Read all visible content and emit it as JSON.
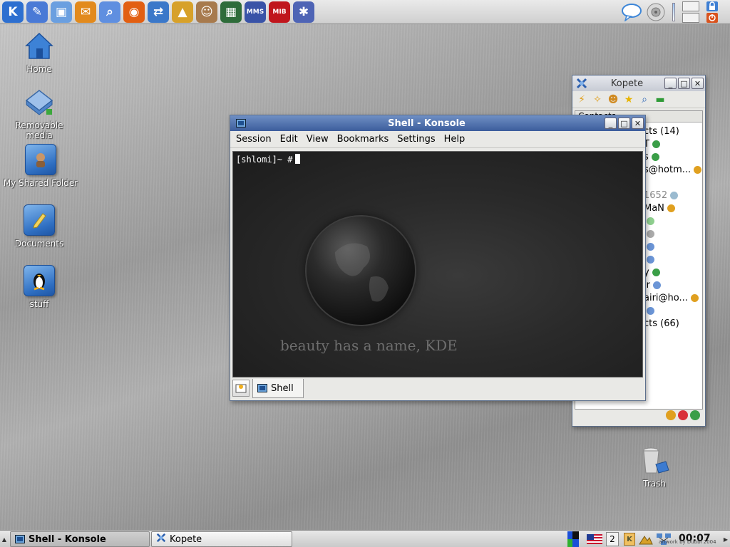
{
  "top_panel": {
    "launchers": [
      {
        "icon": "kde-menu-icon",
        "color": "#2d6fd0",
        "glyph": "K"
      },
      {
        "icon": "text-editor-icon",
        "color": "#4a7ad6",
        "glyph": "✎"
      },
      {
        "icon": "system-icon",
        "color": "#6a9fe0",
        "glyph": "▣"
      },
      {
        "icon": "kmail-icon",
        "color": "#e28a1d",
        "glyph": "✉"
      },
      {
        "icon": "konqueror-icon",
        "color": "#5f8fe0",
        "glyph": "⌕"
      },
      {
        "icon": "firefox-icon",
        "color": "#e25f12",
        "glyph": "◉"
      },
      {
        "icon": "network-icon",
        "color": "#3b78c9",
        "glyph": "⇄"
      },
      {
        "icon": "landscape-icon",
        "color": "#d7a12a",
        "glyph": "▲"
      },
      {
        "icon": "statue-head-icon",
        "color": "#a77a4d",
        "glyph": "☺"
      },
      {
        "icon": "image-viewer-icon",
        "color": "#2e6c3a",
        "glyph": "▦"
      },
      {
        "icon": "mms-icon",
        "color": "#3953a7",
        "glyph": "MMS"
      },
      {
        "icon": "mib-icon",
        "color": "#c0161d",
        "glyph": "MIB"
      },
      {
        "icon": "kde-gear-icon",
        "color": "#4e64b5",
        "glyph": "✱"
      }
    ],
    "tray": [
      {
        "icon": "chat-bubble-icon",
        "color": "#3d86d8"
      },
      {
        "icon": "speaker-icon",
        "color": "#bdbdbd"
      }
    ]
  },
  "desktop_icons": [
    {
      "name": "home",
      "label": "Home",
      "icon": "home-folder-icon"
    },
    {
      "name": "removable-media",
      "label": "Removable\nmedia",
      "icon": "removable-media-icon"
    },
    {
      "name": "my-shared-folder",
      "label": "My Shared Folder",
      "icon": "shared-folder-icon"
    },
    {
      "name": "documents",
      "label": "Documents",
      "icon": "documents-folder-icon"
    },
    {
      "name": "stuff",
      "label": "stuff",
      "icon": "penguin-folder-icon"
    },
    {
      "name": "trash",
      "label": "Trash",
      "icon": "trash-icon"
    }
  ],
  "konsole": {
    "title": "Shell - Konsole",
    "menu": [
      "Session",
      "Edit",
      "View",
      "Bookmarks",
      "Settings",
      "Help"
    ],
    "prompt": "[shlomi]~ #",
    "background_tagline": "beauty has a name, KDE",
    "tab_label": "Shell"
  },
  "kopete": {
    "title": "Kopete",
    "list_header": "Contacts",
    "rows": [
      {
        "text": "cts (14)",
        "dot": null,
        "muted": false
      },
      {
        "text": "T",
        "dot": "#3a9e47",
        "muted": false
      },
      {
        "text": "s",
        "dot": "#3a9e47",
        "muted": false
      },
      {
        "text": "s@hotm...",
        "dot": "#e0a020",
        "muted": false
      },
      {
        "text": "",
        "dot": null,
        "muted": false
      },
      {
        "text": "1652",
        "dot": "#9bbbd0",
        "muted": true
      },
      {
        "text": "MaN",
        "dot": "#e0a020",
        "muted": false
      },
      {
        "text": "",
        "dot": "#8fcf8f",
        "muted": false
      },
      {
        "text": "",
        "dot": "#aaaaaa",
        "muted": false
      },
      {
        "text": "",
        "dot": "#6b95d6",
        "muted": false
      },
      {
        "text": "",
        "dot": "#6b95d6",
        "muted": false
      },
      {
        "text": "y",
        "dot": "#3a9e47",
        "muted": false
      },
      {
        "text": "ir",
        "dot": "#6b95d6",
        "muted": false
      },
      {
        "text": "airi@ho...",
        "dot": "#e0a020",
        "muted": false
      },
      {
        "text": "",
        "dot": "#6b95d6",
        "muted": false
      },
      {
        "text": "cts (66)",
        "dot": null,
        "muted": false
      }
    ],
    "status_icons": [
      "#e0a020",
      "#d9303a",
      "#3a9e47"
    ]
  },
  "taskbar": {
    "tasks": [
      {
        "label": "Shell - Konsole",
        "active": true
      },
      {
        "label": "Kopete",
        "active": false
      }
    ],
    "desktop_number": "2",
    "clock": "00:07",
    "credit": "artwork by Dubbi 2004"
  }
}
